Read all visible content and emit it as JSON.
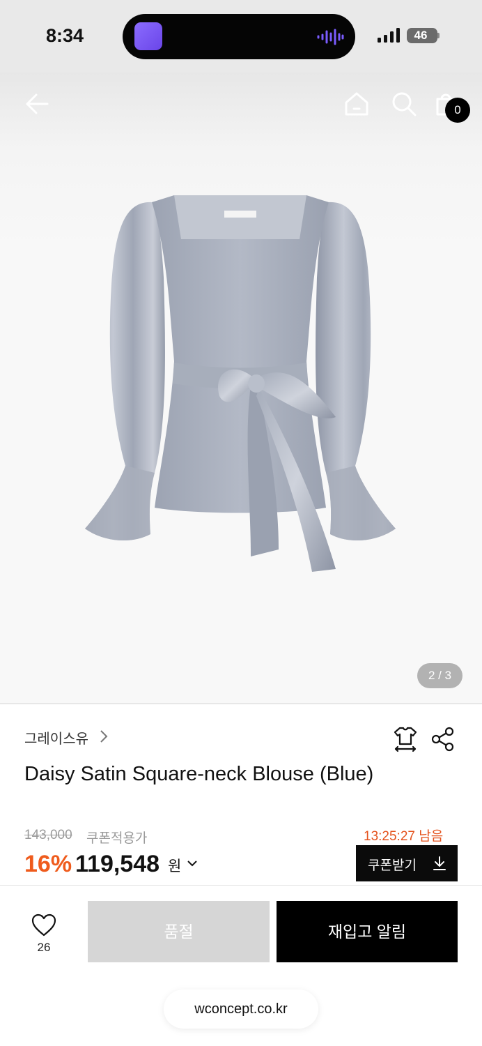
{
  "status_bar": {
    "time": "8:34",
    "battery": "46"
  },
  "header": {
    "icons": [
      "back-arrow-icon",
      "home-icon",
      "search-icon",
      "shopping-bag-icon"
    ],
    "cart_count": "0"
  },
  "gallery": {
    "pager": "2 / 3"
  },
  "product": {
    "brand": "그레이스유",
    "name": "Daisy Satin Square-neck Blouse (Blue)",
    "original_price": "143,000",
    "coupon_label": "쿠폰적용가",
    "countdown": "13:25:27 남음",
    "discount": "16%",
    "sale_price": "119,548",
    "currency": "원",
    "coupon_button": "쿠폰받기"
  },
  "actions": {
    "like_count": "26",
    "soldout_label": "품절",
    "restock_label": "재입고 알림"
  },
  "browser": {
    "url": "wconcept.co.kr"
  },
  "colors": {
    "accent_orange": "#ef5b1c",
    "countdown_red": "#e4521c",
    "primary_black": "#000000",
    "disabled_gray": "#d6d6d6"
  }
}
